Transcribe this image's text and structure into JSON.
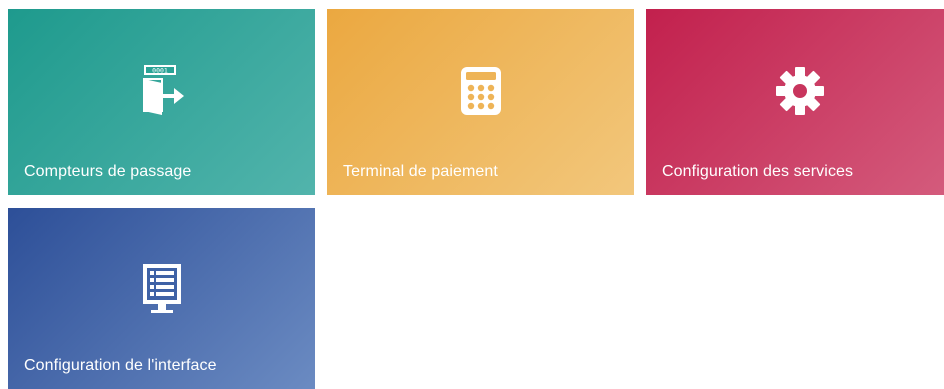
{
  "tiles": [
    {
      "label": "Compteurs de passage",
      "icon": "door-exit-counter-icon",
      "counter_text": "0001",
      "color_start": "#1e9a8d",
      "color_end": "#52b4ac"
    },
    {
      "label": "Terminal de paiement",
      "icon": "calculator-icon",
      "color_start": "#eba840",
      "color_end": "#f2c77c"
    },
    {
      "label": "Configuration des services",
      "icon": "gear-icon",
      "color_start": "#c2204d",
      "color_end": "#d45c7d"
    },
    {
      "label": "Configuration de l'interface",
      "icon": "monitor-list-icon",
      "color_start": "#2d4f98",
      "color_end": "#6b8bc2"
    }
  ]
}
